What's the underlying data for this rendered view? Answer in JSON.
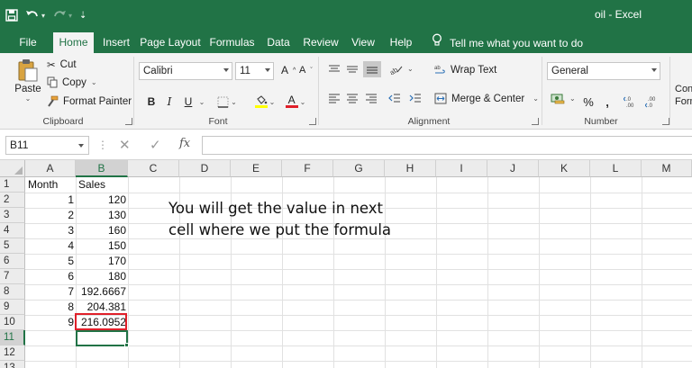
{
  "window": {
    "title": "oil  -  Excel"
  },
  "tabs": [
    {
      "label": "File",
      "active": false
    },
    {
      "label": "Home",
      "active": true
    },
    {
      "label": "Insert",
      "active": false
    },
    {
      "label": "Page Layout",
      "active": false
    },
    {
      "label": "Formulas",
      "active": false
    },
    {
      "label": "Data",
      "active": false
    },
    {
      "label": "Review",
      "active": false
    },
    {
      "label": "View",
      "active": false
    },
    {
      "label": "Help",
      "active": false
    }
  ],
  "tell_me": "Tell me what you want to do",
  "ribbon": {
    "clipboard": {
      "paste": "Paste",
      "cut": "Cut",
      "copy": "Copy",
      "format_painter": "Format Painter",
      "label": "Clipboard"
    },
    "font": {
      "name": "Calibri",
      "size": "11",
      "grow": "A",
      "shrink": "A",
      "bold": "B",
      "italic": "I",
      "underline": "U",
      "font_color_letter": "A",
      "label": "Font",
      "highlight_color": "#ffff00",
      "font_color": "#e0202a"
    },
    "alignment": {
      "wrap_text": "Wrap Text",
      "merge_center": "Merge & Center",
      "label": "Alignment"
    },
    "number": {
      "format": "General",
      "percent": "%",
      "comma": ",",
      "label": "Number",
      "inc_dec": ".00\n→.0",
      "dec_dec": ".00\n→.0"
    },
    "truncated": {
      "line1": "Con",
      "line2": "Form"
    }
  },
  "formula_bar": {
    "name_box": "B11",
    "formula": ""
  },
  "grid": {
    "columns": [
      "A",
      "B",
      "C",
      "D",
      "E",
      "F",
      "G",
      "H",
      "I",
      "J",
      "K",
      "L",
      "M"
    ],
    "rows": [
      "1",
      "2",
      "3",
      "4",
      "5",
      "6",
      "7",
      "8",
      "9",
      "10",
      "11",
      "12",
      "13"
    ],
    "selected_column": "B",
    "selected_row": "11",
    "cells": {
      "A1": "Month",
      "B1": "Sales",
      "A2": "1",
      "B2": "120",
      "A3": "2",
      "B3": "130",
      "A4": "3",
      "B4": "160",
      "A5": "4",
      "B5": "150",
      "A6": "5",
      "B6": "170",
      "A7": "6",
      "B7": "180",
      "A8": "7",
      "B8": "192.6667",
      "A9": "8",
      "B9": "204.381",
      "A10": "9",
      "B10": "216.0952"
    },
    "highlighted_cell": "B10",
    "highlight_color": "#e0202a",
    "accent_color": "#217346"
  },
  "annotation": {
    "line1": "You will get the value in next",
    "line2": "cell where we put the formula"
  }
}
